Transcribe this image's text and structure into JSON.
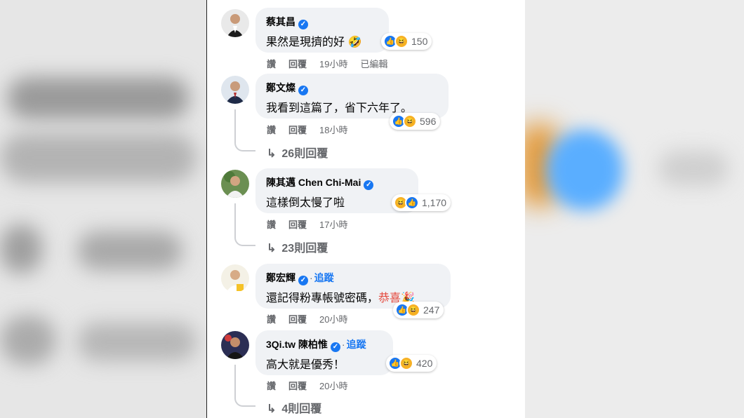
{
  "comments": [
    {
      "name": "蔡其昌",
      "follow": "",
      "text": "果然是現擠的好",
      "text_highlight": "",
      "reaction_count": "150",
      "reaction_icons": [
        "like-icon",
        "haha-icon"
      ],
      "actions": [
        "讚",
        "回覆",
        "19小時",
        "已編輯"
      ],
      "replies": ""
    },
    {
      "name": "鄭文燦",
      "follow": "",
      "text": "我看到這篇了，省下六年了。",
      "text_highlight": "",
      "reaction_count": "596",
      "reaction_icons": [
        "like-icon",
        "haha-icon"
      ],
      "actions": [
        "讚",
        "回覆",
        "18小時"
      ],
      "replies": "26則回覆"
    },
    {
      "name": "陳其邁 Chen Chi-Mai",
      "follow": "",
      "text": "這樣倒太慢了啦",
      "text_highlight": "",
      "reaction_count": "1,170",
      "reaction_icons": [
        "haha-icon",
        "like-icon"
      ],
      "actions": [
        "讚",
        "回覆",
        "17小時"
      ],
      "replies": "23則回覆"
    },
    {
      "name": "鄭宏輝",
      "follow": "追蹤",
      "text": "還記得粉專帳號密碼，",
      "text_highlight": "恭喜",
      "reaction_count": "247",
      "reaction_icons": [
        "like-icon",
        "haha-icon"
      ],
      "actions": [
        "讚",
        "回覆",
        "20小時"
      ],
      "replies": ""
    },
    {
      "name": "3Qi.tw 陳柏惟",
      "follow": "追蹤",
      "text": "高大就是優秀！",
      "text_highlight": "",
      "reaction_count": "420",
      "reaction_icons": [
        "like-icon",
        "haha-icon"
      ],
      "actions": [
        "讚",
        "回覆",
        "20小時"
      ],
      "replies": "4則回覆"
    }
  ],
  "colors": {
    "bubble": "#f0f2f5",
    "link": "#1877f2",
    "muted": "#65676b",
    "highlight": "#e4483c"
  }
}
